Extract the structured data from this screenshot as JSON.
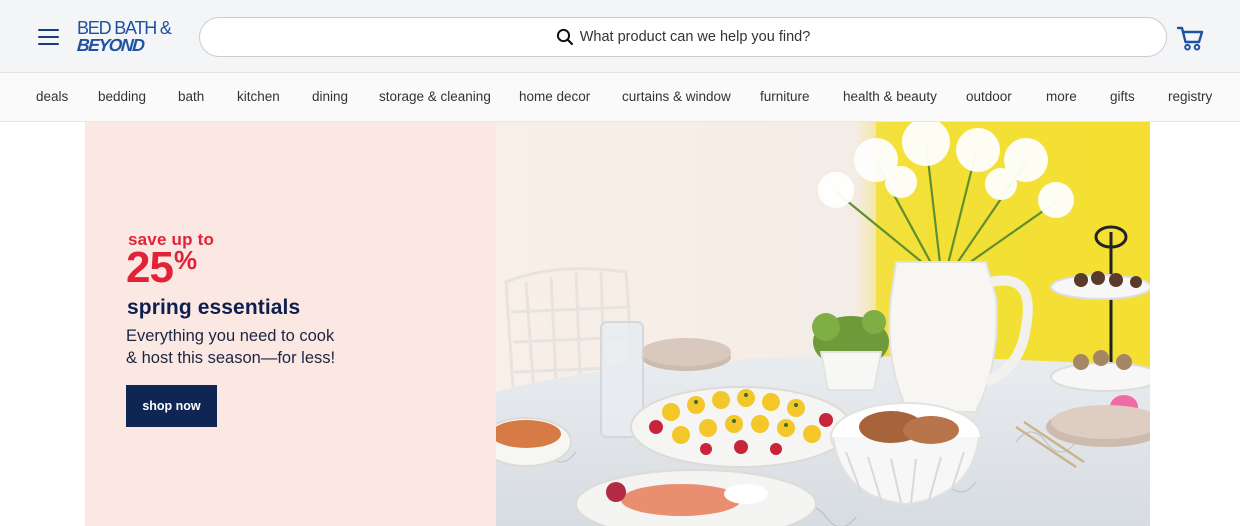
{
  "brand": {
    "line1": "BED BATH &",
    "line2": "BEYOND"
  },
  "search": {
    "placeholder": "What product can we help you find?"
  },
  "nav": {
    "items": [
      {
        "label": "deals"
      },
      {
        "label": "bedding"
      },
      {
        "label": "bath"
      },
      {
        "label": "kitchen"
      },
      {
        "label": "dining"
      },
      {
        "label": "storage & cleaning"
      },
      {
        "label": "home decor"
      },
      {
        "label": "curtains & window"
      },
      {
        "label": "furniture"
      },
      {
        "label": "health & beauty"
      },
      {
        "label": "outdoor"
      },
      {
        "label": "more"
      },
      {
        "label": "gifts"
      },
      {
        "label": "registry"
      }
    ]
  },
  "promo": {
    "save_line": "save up to",
    "percent": "25",
    "percent_sign": "%",
    "title": "spring essentials",
    "subtitle_line1": "Everything you need to cook",
    "subtitle_line2": "& host this season—for less!",
    "cta": "shop now"
  },
  "icons": {
    "menu": "hamburger-menu-icon",
    "search": "search-icon",
    "cart": "cart-icon"
  },
  "colors": {
    "brand_blue": "#1f52a3",
    "promo_red": "#e02338",
    "navy": "#0f2654",
    "promo_bg": "#fbe8e3",
    "header_bg": "#f4f5f6"
  }
}
